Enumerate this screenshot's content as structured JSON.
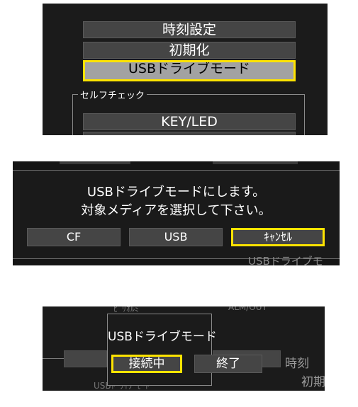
{
  "panel1": {
    "menu": [
      "時刻設定",
      "初期化",
      "USBドライブモード"
    ],
    "selected_index": 2,
    "group_label": "セルフチェック",
    "group_items": [
      "KEY/LED"
    ]
  },
  "panel2": {
    "message_line1": "USBドライブモードにします。",
    "message_line2": "対象メディアを選択して下さい。",
    "buttons": [
      "CF",
      "USB",
      "ｷｬﾝｾﾙ"
    ],
    "background_fragments": [
      "USBドライブモ"
    ]
  },
  "panel3": {
    "title": "USBドライブモード",
    "connecting_label": "接続中",
    "end_label": "終了",
    "background_fragments": [
      "ﾋﾟﾘｵﾙﾐ",
      "ALM/OUT",
      "時刻",
      "初期",
      "USBﾄﾞﾗｲﾌﾞﾓｰﾄﾞ"
    ]
  },
  "colors": {
    "screen_bg": "#1b1b1b",
    "button_bg": "#454545",
    "selected_border": "#ffe300",
    "selected_bg": "#a2a2a2"
  }
}
